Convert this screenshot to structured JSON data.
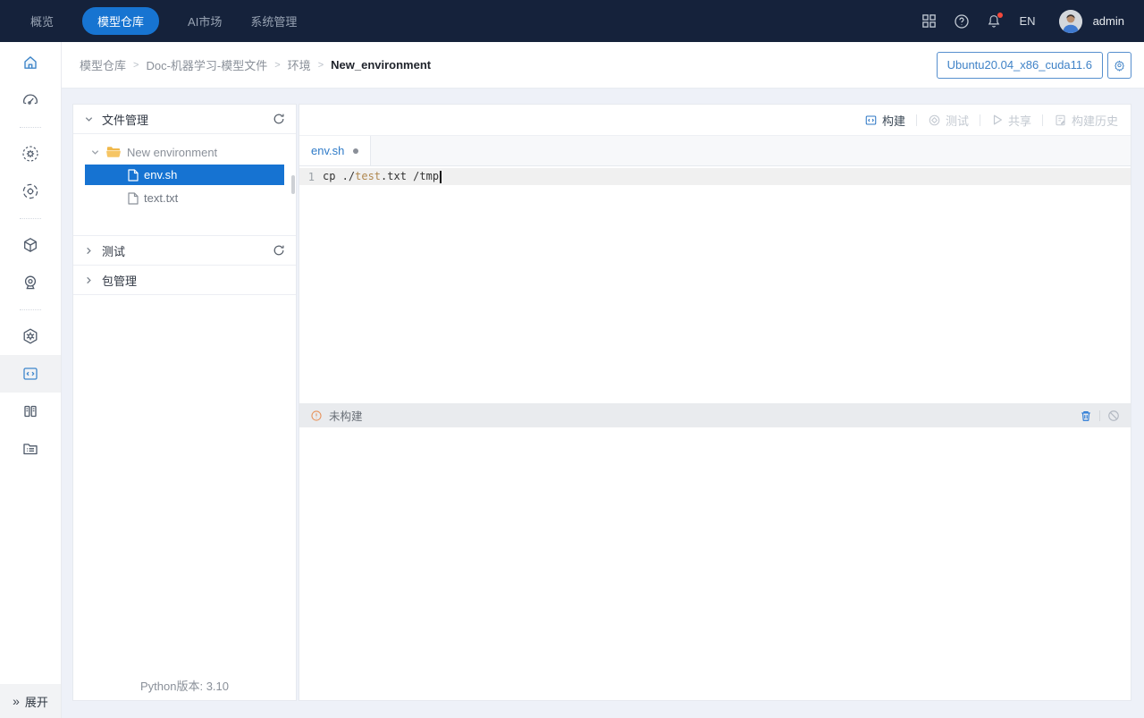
{
  "navbar": {
    "items": [
      {
        "label": "概览"
      },
      {
        "label": "模型仓库",
        "active": true
      },
      {
        "label": "AI市场"
      },
      {
        "label": "系统管理"
      }
    ],
    "language": "EN",
    "username": "admin"
  },
  "breadcrumb": {
    "items": [
      "模型仓库",
      "Doc-机器学习-模型文件",
      "环境",
      "New_environment"
    ]
  },
  "header": {
    "env_name": "Ubuntu20.04_x86_cuda11.6"
  },
  "sidebar": {
    "expand_label": "展开",
    "expand_icon": "chevrons-right"
  },
  "file_panel": {
    "files_section": "文件管理",
    "test_section": "测试",
    "package_section": "包管理",
    "folder_name": "New environment",
    "files": [
      {
        "name": "env.sh",
        "selected": true
      },
      {
        "name": "text.txt",
        "selected": false
      }
    ],
    "python_version": "Python版本: 3.10"
  },
  "editor": {
    "toolbar": {
      "build": "构建",
      "test": "测试",
      "share": "共享",
      "build_history": "构建历史"
    },
    "tab_name": "env.sh",
    "code": {
      "line_number": "1",
      "before": "cp ./",
      "highlight": "test",
      "after": ".txt /tmp"
    }
  },
  "console": {
    "status": "未构建"
  },
  "colors": {
    "navbar_bg": "#15223b",
    "accent_blue": "#1673d2",
    "selected_file_bg": "#1673d2",
    "warning_orange": "#e8935c",
    "code_token": "#b08850"
  }
}
